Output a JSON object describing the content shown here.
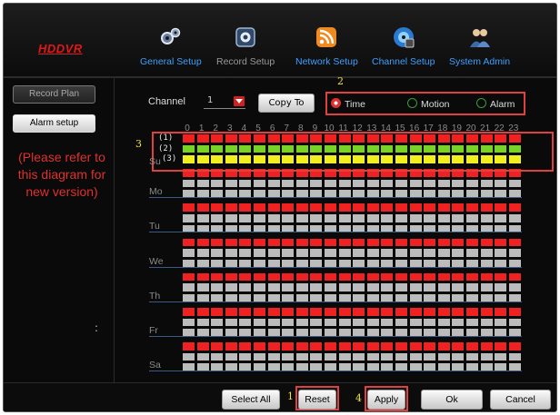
{
  "app": {
    "logo": "HDDVR"
  },
  "nav": [
    {
      "label": "General Setup",
      "icon": "gears-icon",
      "active": true
    },
    {
      "label": "Record Setup",
      "icon": "camera-icon",
      "active": false
    },
    {
      "label": "Network Setup",
      "icon": "wifi-icon",
      "active": true
    },
    {
      "label": "Channel Setup",
      "icon": "disc-icon",
      "active": true
    },
    {
      "label": "System Admin",
      "icon": "users-icon",
      "active": true
    }
  ],
  "sidebar": {
    "record_plan": "Record Plan",
    "alarm_setup": "Alarm setup",
    "notice": "(Please refer to this diagram for new version)",
    "colon": ":"
  },
  "channel": {
    "label": "Channel",
    "value": "1",
    "copy_to": "Copy To"
  },
  "record_types": [
    {
      "label": "Time",
      "selected": true
    },
    {
      "label": "Motion",
      "selected": false
    },
    {
      "label": "Alarm",
      "selected": false
    }
  ],
  "callouts": {
    "c1": "1",
    "c2": "2",
    "c3": "3",
    "c4": "4"
  },
  "hours": [
    "0",
    "1",
    "2",
    "3",
    "4",
    "5",
    "6",
    "7",
    "8",
    "9",
    "10",
    "11",
    "12",
    "13",
    "14",
    "15",
    "16",
    "17",
    "18",
    "19",
    "20",
    "21",
    "22",
    "23"
  ],
  "row_tags": [
    "(1)",
    "(2)",
    "(3)"
  ],
  "days": [
    "Su",
    "Mo",
    "Tu",
    "We",
    "Th",
    "Fr",
    "Sa"
  ],
  "schedule_colors": {
    "time": "#ee2222",
    "motion": "#7ad226",
    "alarm": "#f0f020",
    "off": "#bcbcbc"
  },
  "schedule": {
    "Su": [
      "time",
      "motion",
      "alarm"
    ],
    "Mo": [
      "time",
      "off",
      "off"
    ],
    "Tu": [
      "time",
      "off",
      "off"
    ],
    "We": [
      "time",
      "off",
      "off"
    ],
    "Th": [
      "time",
      "off",
      "off"
    ],
    "Fr": [
      "time",
      "off",
      "off"
    ],
    "Sa": [
      "time",
      "off",
      "off"
    ]
  },
  "buttons": {
    "select_all": "Select All",
    "reset": "Reset",
    "apply": "Apply",
    "ok": "Ok",
    "cancel": "Cancel"
  }
}
